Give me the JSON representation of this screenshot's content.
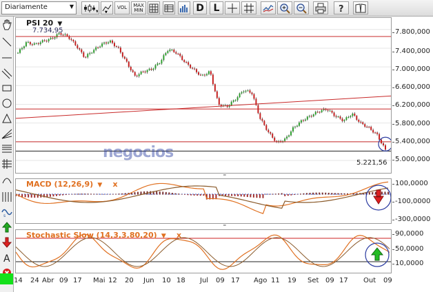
{
  "toolbar": {
    "period_select_value": "Diariamente",
    "vol_label": "VOL",
    "maxmin_top": "MAX",
    "maxmin_bottom": "MIN",
    "d_label": "D",
    "l_label": "L"
  },
  "main_chart": {
    "symbol": "PSI 20",
    "symbol_arrow": "▼",
    "high_label": "7.734,95",
    "last_label": "5.221,56",
    "watermark": "negocios",
    "y_ticks": [
      "7.800,000",
      "7.400,000",
      "7.000,000",
      "6.600,000",
      "6.200,000",
      "5.800,000",
      "5.400,000",
      "5.000,000"
    ]
  },
  "macd": {
    "title": "MACD (12,26,9)",
    "arrow": "▼",
    "close": "x",
    "y_ticks": [
      "100,0000",
      "-100,0000",
      "-300,0000"
    ]
  },
  "stochastic": {
    "title": "Stochastic Slow (14,3,3,80,20)",
    "arrow": "▼",
    "close": "x",
    "y_ticks": [
      "90,0000",
      "50,0000",
      "10,0000"
    ]
  },
  "x_axis": [
    "14",
    "24",
    "Abr",
    "09",
    "17",
    "Mai",
    "12",
    "20",
    "Jun",
    "10",
    "18",
    "Jul",
    "09",
    "17",
    "Ago",
    "11",
    "19",
    "Set",
    "09",
    "17",
    "Out",
    "09"
  ],
  "colors": {
    "bull_candle": "#2e9e2e",
    "bear_candle": "#c42020",
    "support_line": "#c82828",
    "macd_line": "#e07020",
    "signal_line": "#8a5a2a"
  },
  "chart_data": {
    "type": "line",
    "title": "PSI 20",
    "ylim": [
      5000,
      7900
    ],
    "series": [
      {
        "values": [
          7300,
          7520,
          7480,
          7550,
          7600,
          7720,
          7650,
          7450,
          7200,
          7350,
          7480,
          7550,
          7400,
          7100,
          6800,
          6900,
          6950,
          7100,
          7380,
          7300,
          7100,
          6950,
          6800,
          6900,
          6200,
          6150,
          6300,
          6500,
          6450,
          5900,
          5600,
          5380,
          5450,
          5700,
          5850,
          5950,
          6050,
          6100,
          5950,
          5850,
          6000,
          5800,
          5700,
          5550,
          5221.56
        ]
      }
    ]
  }
}
